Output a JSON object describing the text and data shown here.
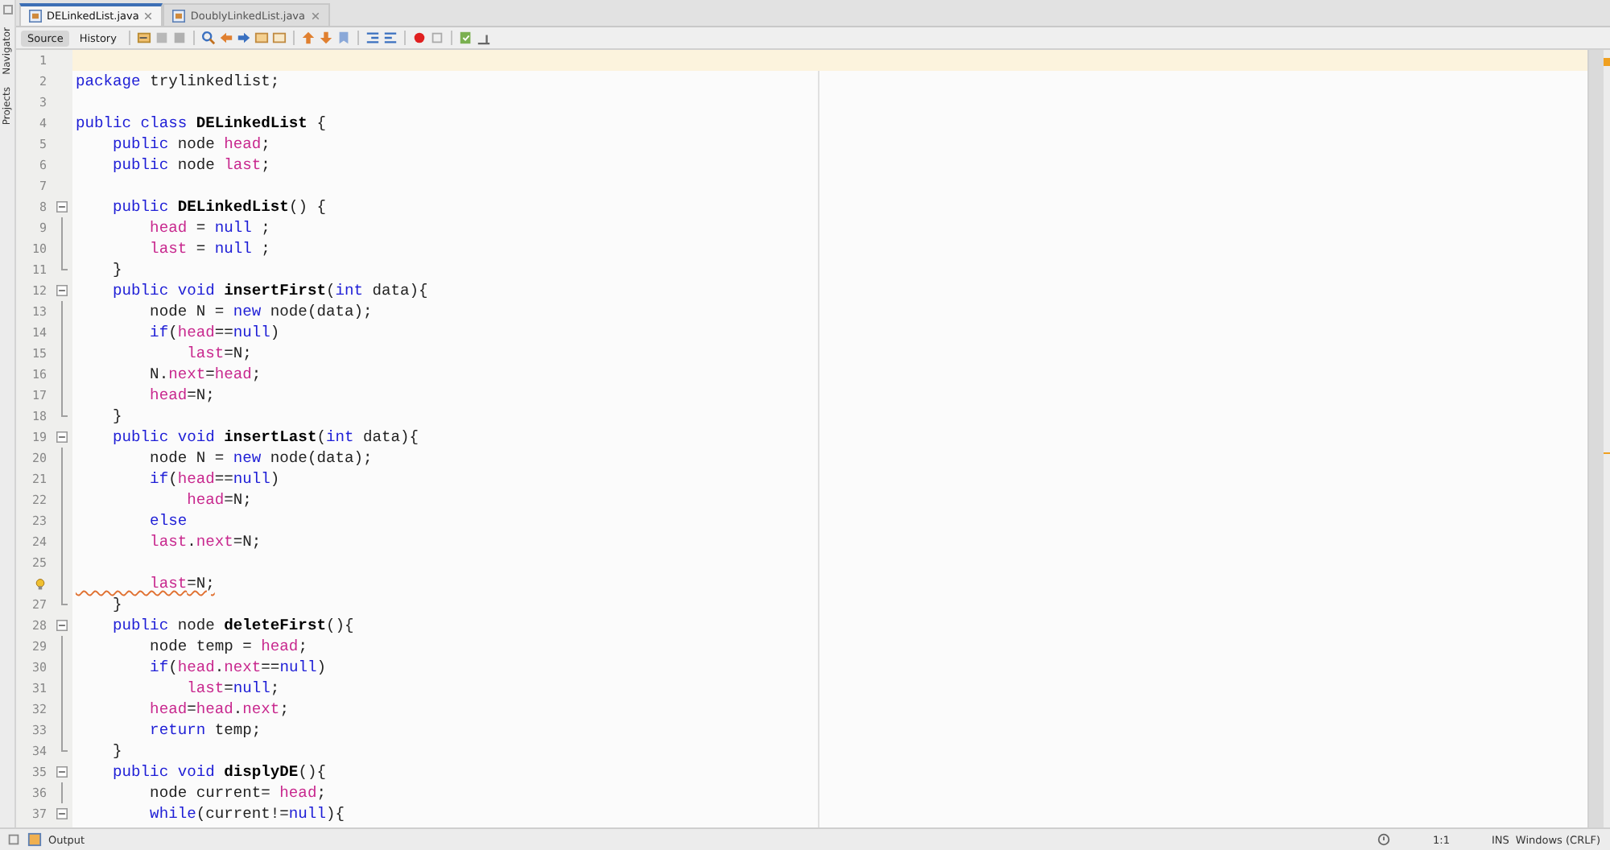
{
  "side_tabs": [
    {
      "label": "Navigator"
    },
    {
      "label": "Projects"
    }
  ],
  "file_tabs": [
    {
      "label": "DELinkedList.java",
      "selected": true
    },
    {
      "label": "DoublyLinkedList.java",
      "selected": false
    }
  ],
  "view_tabs": [
    {
      "label": "Source",
      "selected": true
    },
    {
      "label": "History",
      "selected": false
    }
  ],
  "lines": [
    {
      "number": "1",
      "current": true
    },
    {
      "number": "2",
      "tokens": [
        {
          "kind": "kw",
          "text": "package"
        },
        {
          "kind": "plain",
          "text": " trylinkedlist;"
        }
      ]
    },
    {
      "number": "3"
    },
    {
      "number": "4",
      "tokens": [
        {
          "kind": "kw",
          "text": "public class "
        },
        {
          "kind": "bold",
          "text": "DELinkedList"
        },
        {
          "kind": "plain",
          "text": " {"
        }
      ]
    },
    {
      "number": "5",
      "tokens": [
        {
          "kind": "kw",
          "text": "    public"
        },
        {
          "kind": "plain",
          "text": " node "
        },
        {
          "kind": "field",
          "text": "head"
        },
        {
          "kind": "plain",
          "text": ";"
        }
      ]
    },
    {
      "number": "6",
      "tokens": [
        {
          "kind": "kw",
          "text": "    public"
        },
        {
          "kind": "plain",
          "text": " node "
        },
        {
          "kind": "field",
          "text": "last"
        },
        {
          "kind": "plain",
          "text": ";"
        }
      ]
    },
    {
      "number": "7"
    },
    {
      "number": "8",
      "fold_marker": true,
      "tokens": [
        {
          "kind": "kw",
          "text": "    public "
        },
        {
          "kind": "bold",
          "text": "DELinkedList"
        },
        {
          "kind": "plain",
          "text": "() {"
        }
      ]
    },
    {
      "number": "9",
      "in_fold": true,
      "tokens": [
        {
          "kind": "field",
          "text": "        head"
        },
        {
          "kind": "plain",
          "text": " = "
        },
        {
          "kind": "kw",
          "text": "null"
        },
        {
          "kind": "plain",
          "text": " ;"
        }
      ]
    },
    {
      "number": "10",
      "in_fold": true,
      "tokens": [
        {
          "kind": "field",
          "text": "        last"
        },
        {
          "kind": "plain",
          "text": " = "
        },
        {
          "kind": "kw",
          "text": "null"
        },
        {
          "kind": "plain",
          "text": " ;"
        }
      ]
    },
    {
      "number": "11",
      "fold_end": true,
      "tokens": [
        {
          "kind": "plain",
          "text": "    }"
        }
      ]
    },
    {
      "number": "12",
      "fold_marker": true,
      "tokens": [
        {
          "kind": "kw",
          "text": "    public void "
        },
        {
          "kind": "bold",
          "text": "insertFirst"
        },
        {
          "kind": "plain",
          "text": "("
        },
        {
          "kind": "kw",
          "text": "int"
        },
        {
          "kind": "plain",
          "text": " data){"
        }
      ]
    },
    {
      "number": "13",
      "in_fold": true,
      "tokens": [
        {
          "kind": "plain",
          "text": "        node N = "
        },
        {
          "kind": "kw",
          "text": "new"
        },
        {
          "kind": "plain",
          "text": " node(data);"
        }
      ]
    },
    {
      "number": "14",
      "in_fold": true,
      "tokens": [
        {
          "kind": "kw",
          "text": "        if"
        },
        {
          "kind": "plain",
          "text": "("
        },
        {
          "kind": "field",
          "text": "head"
        },
        {
          "kind": "plain",
          "text": "=="
        },
        {
          "kind": "kw",
          "text": "null"
        },
        {
          "kind": "plain",
          "text": ")"
        }
      ]
    },
    {
      "number": "15",
      "in_fold": true,
      "tokens": [
        {
          "kind": "field",
          "text": "            last"
        },
        {
          "kind": "plain",
          "text": "=N;"
        }
      ]
    },
    {
      "number": "16",
      "in_fold": true,
      "tokens": [
        {
          "kind": "plain",
          "text": "        N."
        },
        {
          "kind": "field",
          "text": "next"
        },
        {
          "kind": "plain",
          "text": "="
        },
        {
          "kind": "field",
          "text": "head"
        },
        {
          "kind": "plain",
          "text": ";"
        }
      ]
    },
    {
      "number": "17",
      "in_fold": true,
      "tokens": [
        {
          "kind": "field",
          "text": "        head"
        },
        {
          "kind": "plain",
          "text": "=N;"
        }
      ]
    },
    {
      "number": "18",
      "fold_end": true,
      "tokens": [
        {
          "kind": "plain",
          "text": "    }"
        }
      ]
    },
    {
      "number": "19",
      "fold_marker": true,
      "tokens": [
        {
          "kind": "kw",
          "text": "    public void "
        },
        {
          "kind": "bold",
          "text": "insertLast"
        },
        {
          "kind": "plain",
          "text": "("
        },
        {
          "kind": "kw",
          "text": "int"
        },
        {
          "kind": "plain",
          "text": " data){"
        }
      ]
    },
    {
      "number": "20",
      "in_fold": true,
      "tokens": [
        {
          "kind": "plain",
          "text": "        node N = "
        },
        {
          "kind": "kw",
          "text": "new"
        },
        {
          "kind": "plain",
          "text": " node(data);"
        }
      ]
    },
    {
      "number": "21",
      "in_fold": true,
      "tokens": [
        {
          "kind": "kw",
          "text": "        if"
        },
        {
          "kind": "plain",
          "text": "("
        },
        {
          "kind": "field",
          "text": "head"
        },
        {
          "kind": "plain",
          "text": "=="
        },
        {
          "kind": "kw",
          "text": "null"
        },
        {
          "kind": "plain",
          "text": ")"
        }
      ]
    },
    {
      "number": "22",
      "in_fold": true,
      "tokens": [
        {
          "kind": "field",
          "text": "            head"
        },
        {
          "kind": "plain",
          "text": "=N;"
        }
      ]
    },
    {
      "number": "23",
      "in_fold": true,
      "tokens": [
        {
          "kind": "kw",
          "text": "        else"
        }
      ]
    },
    {
      "number": "24",
      "in_fold": true,
      "tokens": [
        {
          "kind": "field",
          "text": "        last"
        },
        {
          "kind": "plain",
          "text": "."
        },
        {
          "kind": "field",
          "text": "next"
        },
        {
          "kind": "plain",
          "text": "=N;"
        }
      ]
    },
    {
      "number": "25",
      "in_fold": true
    },
    {
      "warning": true,
      "in_fold": true,
      "tokens": [
        {
          "kind": "field",
          "text": "        last"
        },
        {
          "kind": "plain",
          "text": "=N;"
        }
      ]
    },
    {
      "number": "27",
      "fold_end": true,
      "tokens": [
        {
          "kind": "plain",
          "text": "    }"
        }
      ]
    },
    {
      "number": "28",
      "fold_marker": true,
      "tokens": [
        {
          "kind": "kw",
          "text": "    public"
        },
        {
          "kind": "plain",
          "text": " node "
        },
        {
          "kind": "bold",
          "text": "deleteFirst"
        },
        {
          "kind": "plain",
          "text": "(){"
        }
      ]
    },
    {
      "number": "29",
      "in_fold": true,
      "tokens": [
        {
          "kind": "plain",
          "text": "        node temp = "
        },
        {
          "kind": "field",
          "text": "head"
        },
        {
          "kind": "plain",
          "text": ";"
        }
      ]
    },
    {
      "number": "30",
      "in_fold": true,
      "tokens": [
        {
          "kind": "kw",
          "text": "        if"
        },
        {
          "kind": "plain",
          "text": "("
        },
        {
          "kind": "field",
          "text": "head"
        },
        {
          "kind": "plain",
          "text": "."
        },
        {
          "kind": "field",
          "text": "next"
        },
        {
          "kind": "plain",
          "text": "=="
        },
        {
          "kind": "kw",
          "text": "null"
        },
        {
          "kind": "plain",
          "text": ")"
        }
      ]
    },
    {
      "number": "31",
      "in_fold": true,
      "tokens": [
        {
          "kind": "field",
          "text": "            last"
        },
        {
          "kind": "plain",
          "text": "="
        },
        {
          "kind": "kw",
          "text": "null"
        },
        {
          "kind": "plain",
          "text": ";"
        }
      ]
    },
    {
      "number": "32",
      "in_fold": true,
      "tokens": [
        {
          "kind": "field",
          "text": "        head"
        },
        {
          "kind": "plain",
          "text": "="
        },
        {
          "kind": "field",
          "text": "head"
        },
        {
          "kind": "plain",
          "text": "."
        },
        {
          "kind": "field",
          "text": "next"
        },
        {
          "kind": "plain",
          "text": ";"
        }
      ]
    },
    {
      "number": "33",
      "in_fold": true,
      "tokens": [
        {
          "kind": "kw",
          "text": "        return"
        },
        {
          "kind": "plain",
          "text": " temp;"
        }
      ]
    },
    {
      "number": "34",
      "fold_end": true,
      "tokens": [
        {
          "kind": "plain",
          "text": "    }"
        }
      ]
    },
    {
      "number": "35",
      "fold_marker": true,
      "tokens": [
        {
          "kind": "kw",
          "text": "    public void "
        },
        {
          "kind": "bold",
          "text": "displyDE"
        },
        {
          "kind": "plain",
          "text": "(){"
        }
      ]
    },
    {
      "number": "36",
      "in_fold": true,
      "tokens": [
        {
          "kind": "plain",
          "text": "        node current= "
        },
        {
          "kind": "field",
          "text": "head"
        },
        {
          "kind": "plain",
          "text": ";"
        }
      ]
    },
    {
      "number": "37",
      "fold_marker": true,
      "tokens": [
        {
          "kind": "kw",
          "text": "        while"
        },
        {
          "kind": "plain",
          "text": "(current!="
        },
        {
          "kind": "kw",
          "text": "null"
        },
        {
          "kind": "plain",
          "text": "){"
        }
      ]
    }
  ],
  "status_bar": {
    "output_tab": "Output",
    "position": "1:1",
    "mode": "INS",
    "line_endings": "Windows (CRLF)"
  }
}
